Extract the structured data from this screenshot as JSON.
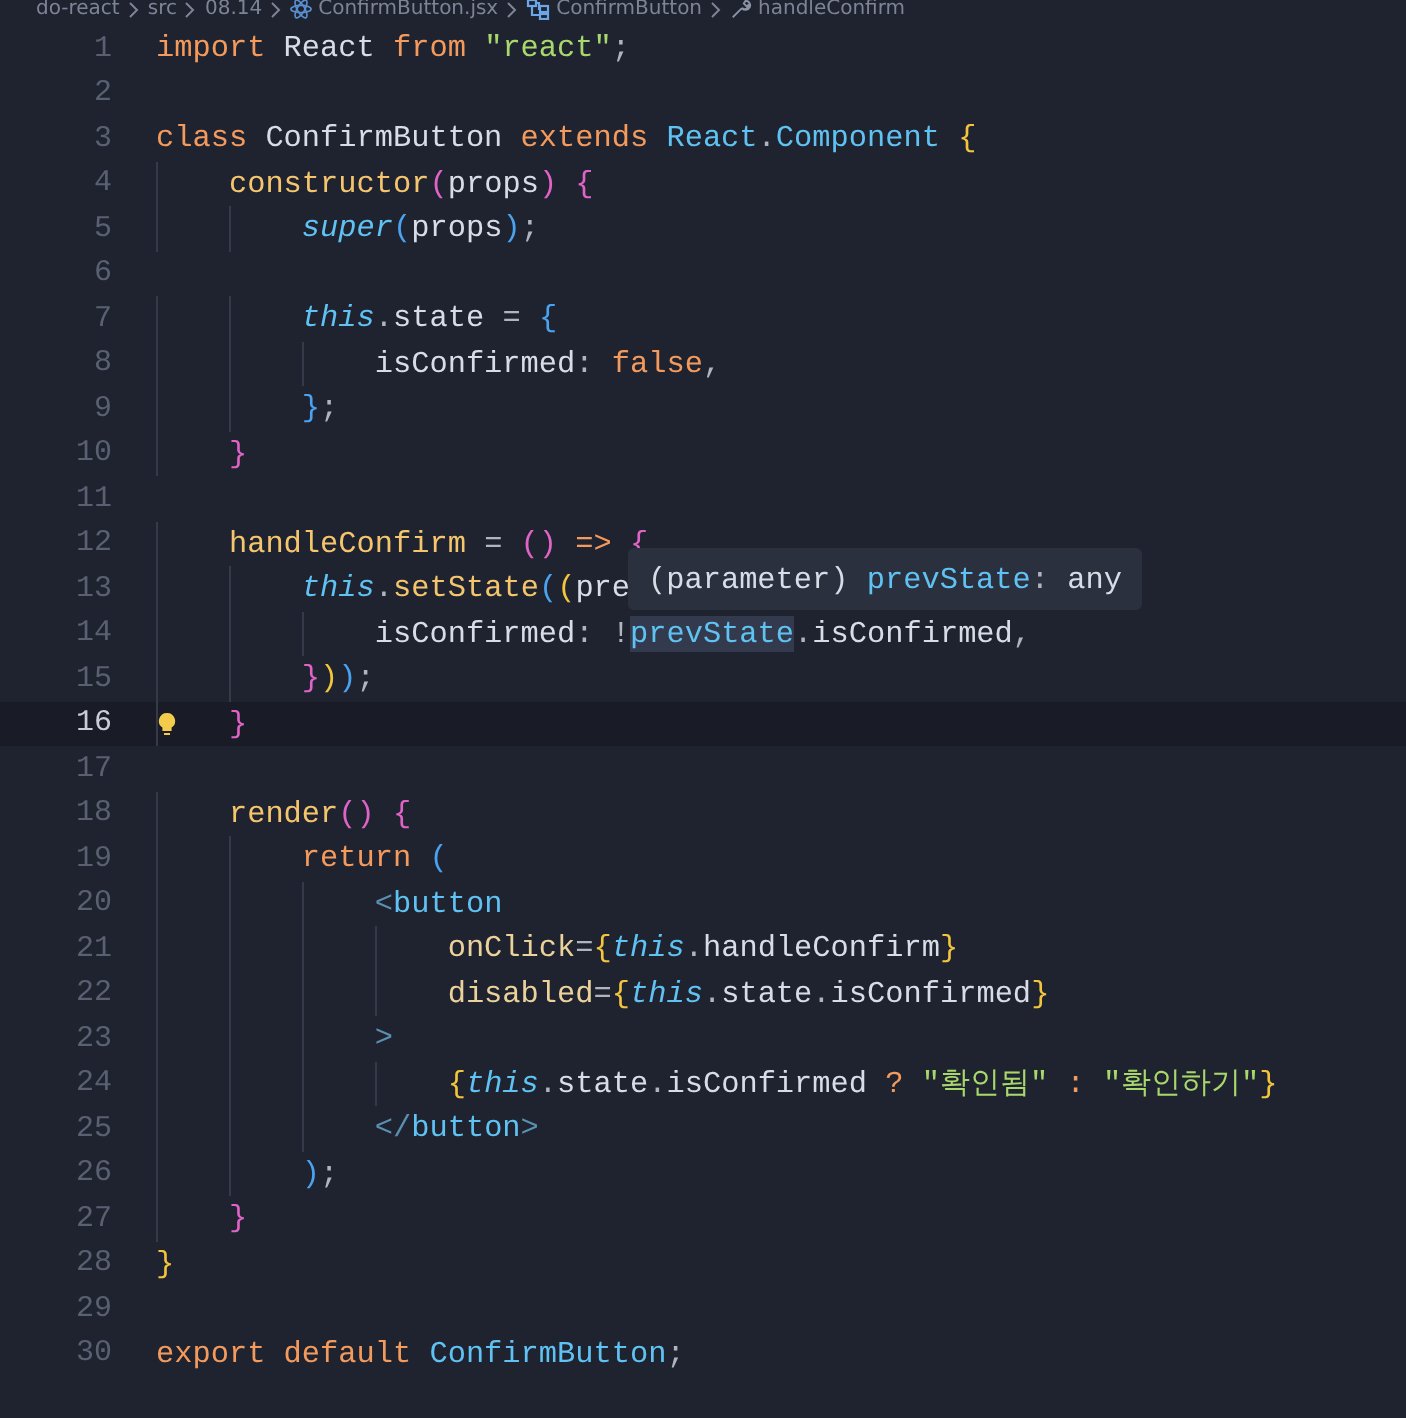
{
  "breadcrumb": [
    {
      "text": "do-react",
      "kind": "folder"
    },
    {
      "text": "src",
      "kind": "folder"
    },
    {
      "text": "08.14",
      "kind": "folder"
    },
    {
      "text": "ConfirmButton.jsx",
      "kind": "react"
    },
    {
      "text": "ConfirmButton",
      "kind": "class"
    },
    {
      "text": "handleConfirm",
      "kind": "method"
    }
  ],
  "lines": [
    {
      "number": "1",
      "current": false,
      "tokens": [
        {
          "text": "import",
          "kind": "kw"
        },
        {
          "text": " React ",
          "kind": "plain"
        },
        {
          "text": "from ",
          "kind": "kw"
        },
        {
          "text": "\"react\"",
          "kind": "str"
        },
        {
          "text": ";",
          "kind": "punct"
        }
      ]
    },
    {
      "number": "2",
      "current": false
    },
    {
      "number": "3",
      "current": false,
      "tokens": [
        {
          "text": "class",
          "kind": "kw"
        },
        {
          "text": " ConfirmButton ",
          "kind": "plain"
        },
        {
          "text": "extends ",
          "kind": "kw"
        },
        {
          "text": "React",
          "kind": "cls"
        },
        {
          "text": ".",
          "kind": "punct"
        },
        {
          "text": "Component ",
          "kind": "cls"
        },
        {
          "text": "{",
          "kind": "b1"
        }
      ]
    },
    {
      "number": "4",
      "current": false,
      "tokens": [
        {
          "text": "    constructor",
          "kind": "fn"
        },
        {
          "text": "(",
          "kind": "b2"
        },
        {
          "text": "props",
          "kind": "plain"
        },
        {
          "text": ") {",
          "kind": "b2"
        }
      ]
    },
    {
      "number": "5",
      "current": false,
      "tokens": [
        {
          "text": "        super",
          "kind": "this"
        },
        {
          "text": "(",
          "kind": "b3"
        },
        {
          "text": "props",
          "kind": "plain"
        },
        {
          "text": ")",
          "kind": "b3"
        },
        {
          "text": ";",
          "kind": "punct"
        }
      ]
    },
    {
      "number": "6",
      "current": false
    },
    {
      "number": "7",
      "current": false,
      "tokens": [
        {
          "text": "        this",
          "kind": "this"
        },
        {
          "text": ".",
          "kind": "punct"
        },
        {
          "text": "state",
          "kind": "plain"
        },
        {
          "text": " = ",
          "kind": "punct"
        },
        {
          "text": "{",
          "kind": "b3"
        }
      ]
    },
    {
      "number": "8",
      "current": false,
      "tokens": [
        {
          "text": "            isConfirmed",
          "kind": "plain"
        },
        {
          "text": ": ",
          "kind": "punct"
        },
        {
          "text": "false",
          "kind": "kw"
        },
        {
          "text": ",",
          "kind": "punct"
        }
      ]
    },
    {
      "number": "9",
      "current": false,
      "tokens": [
        {
          "text": "        }",
          "kind": "b3"
        },
        {
          "text": ";",
          "kind": "punct"
        }
      ]
    },
    {
      "number": "10",
      "current": false,
      "tokens": [
        {
          "text": "    }",
          "kind": "b2"
        }
      ]
    },
    {
      "number": "11",
      "current": false
    },
    {
      "number": "12",
      "current": false,
      "tokens": [
        {
          "text": "    handleConfirm",
          "kind": "fn"
        },
        {
          "text": " = ",
          "kind": "punct"
        },
        {
          "text": "() ",
          "kind": "b2"
        },
        {
          "text": "=> ",
          "kind": "kw"
        },
        {
          "text": "{",
          "kind": "b2"
        }
      ]
    },
    {
      "number": "13",
      "current": false,
      "tokens": [
        {
          "text": "        this",
          "kind": "this"
        },
        {
          "text": ".",
          "kind": "punct"
        },
        {
          "text": "setState",
          "kind": "fn"
        },
        {
          "text": "(",
          "kind": "b3"
        },
        {
          "text": "(",
          "kind": "b1"
        },
        {
          "text": "pre",
          "kind": "plain"
        }
      ]
    },
    {
      "number": "14",
      "current": false,
      "tokens": [
        {
          "text": "            isConfirmed",
          "kind": "plain"
        },
        {
          "text": ": ",
          "kind": "punct"
        },
        {
          "text": "!",
          "kind": "punct"
        },
        {
          "text": "prevState",
          "kind": "hover"
        },
        {
          "text": ".",
          "kind": "punct"
        },
        {
          "text": "isConfirmed",
          "kind": "plain"
        },
        {
          "text": ",",
          "kind": "punct"
        }
      ]
    },
    {
      "number": "15",
      "current": false,
      "tokens": [
        {
          "text": "        }",
          "kind": "b2"
        },
        {
          "text": ")",
          "kind": "b1"
        },
        {
          "text": ")",
          "kind": "b3"
        },
        {
          "text": ";",
          "kind": "punct"
        }
      ]
    },
    {
      "number": "16",
      "current": true,
      "tokens": [
        {
          "text": "    }",
          "kind": "b2"
        }
      ]
    },
    {
      "number": "17",
      "current": false
    },
    {
      "number": "18",
      "current": false,
      "tokens": [
        {
          "text": "    render",
          "kind": "fn"
        },
        {
          "text": "() {",
          "kind": "b2"
        }
      ]
    },
    {
      "number": "19",
      "current": false,
      "tokens": [
        {
          "text": "        return ",
          "kind": "kw"
        },
        {
          "text": "(",
          "kind": "b3"
        }
      ]
    },
    {
      "number": "20",
      "current": false,
      "tokens": [
        {
          "text": "            <",
          "kind": "tagp"
        },
        {
          "text": "button",
          "kind": "tag"
        }
      ]
    },
    {
      "number": "21",
      "current": false,
      "tokens": [
        {
          "text": "                onClick",
          "kind": "attr"
        },
        {
          "text": "=",
          "kind": "punct"
        },
        {
          "text": "{",
          "kind": "b1"
        },
        {
          "text": "this",
          "kind": "this"
        },
        {
          "text": ".",
          "kind": "punct"
        },
        {
          "text": "handleConfirm",
          "kind": "plain"
        },
        {
          "text": "}",
          "kind": "b1"
        }
      ]
    },
    {
      "number": "22",
      "current": false,
      "tokens": [
        {
          "text": "                disabled",
          "kind": "attr"
        },
        {
          "text": "=",
          "kind": "punct"
        },
        {
          "text": "{",
          "kind": "b1"
        },
        {
          "text": "this",
          "kind": "this"
        },
        {
          "text": ".",
          "kind": "punct"
        },
        {
          "text": "state",
          "kind": "plain"
        },
        {
          "text": ".",
          "kind": "punct"
        },
        {
          "text": "isConfirmed",
          "kind": "plain"
        },
        {
          "text": "}",
          "kind": "b1"
        }
      ]
    },
    {
      "number": "23",
      "current": false,
      "tokens": [
        {
          "text": "            >",
          "kind": "tagp"
        }
      ]
    },
    {
      "number": "24",
      "current": false,
      "tokens": [
        {
          "text": "                {",
          "kind": "b1"
        },
        {
          "text": "this",
          "kind": "this"
        },
        {
          "text": ".",
          "kind": "punct"
        },
        {
          "text": "state",
          "kind": "plain"
        },
        {
          "text": ".",
          "kind": "punct"
        },
        {
          "text": "isConfirmed ",
          "kind": "plain"
        },
        {
          "text": "? ",
          "kind": "kw"
        },
        {
          "text": "\"확인됨\" ",
          "kind": "str"
        },
        {
          "text": ": ",
          "kind": "kw"
        },
        {
          "text": "\"확인하기\"",
          "kind": "str"
        },
        {
          "text": "}",
          "kind": "b1"
        }
      ]
    },
    {
      "number": "25",
      "current": false,
      "tokens": [
        {
          "text": "            </",
          "kind": "tagp"
        },
        {
          "text": "button",
          "kind": "tag"
        },
        {
          "text": ">",
          "kind": "tagp"
        }
      ]
    },
    {
      "number": "26",
      "current": false,
      "tokens": [
        {
          "text": "        )",
          "kind": "b3"
        },
        {
          "text": ";",
          "kind": "punct"
        }
      ]
    },
    {
      "number": "27",
      "current": false,
      "tokens": [
        {
          "text": "    }",
          "kind": "b2"
        }
      ]
    },
    {
      "number": "28",
      "current": false,
      "tokens": [
        {
          "text": "}",
          "kind": "b1"
        }
      ]
    },
    {
      "number": "29",
      "current": false
    },
    {
      "number": "30",
      "current": false,
      "tokens": [
        {
          "text": "export default ",
          "kind": "kw"
        },
        {
          "text": "ConfirmButton",
          "kind": "cls"
        },
        {
          "text": ";",
          "kind": "punct"
        }
      ]
    }
  ],
  "hover_tooltip": {
    "tokens": [
      {
        "text": "(parameter) ",
        "kind": "plain"
      },
      {
        "text": "prevState",
        "kind": "cls"
      },
      {
        "text": ": ",
        "kind": "punct"
      },
      {
        "text": "any",
        "kind": "plain"
      }
    ]
  }
}
